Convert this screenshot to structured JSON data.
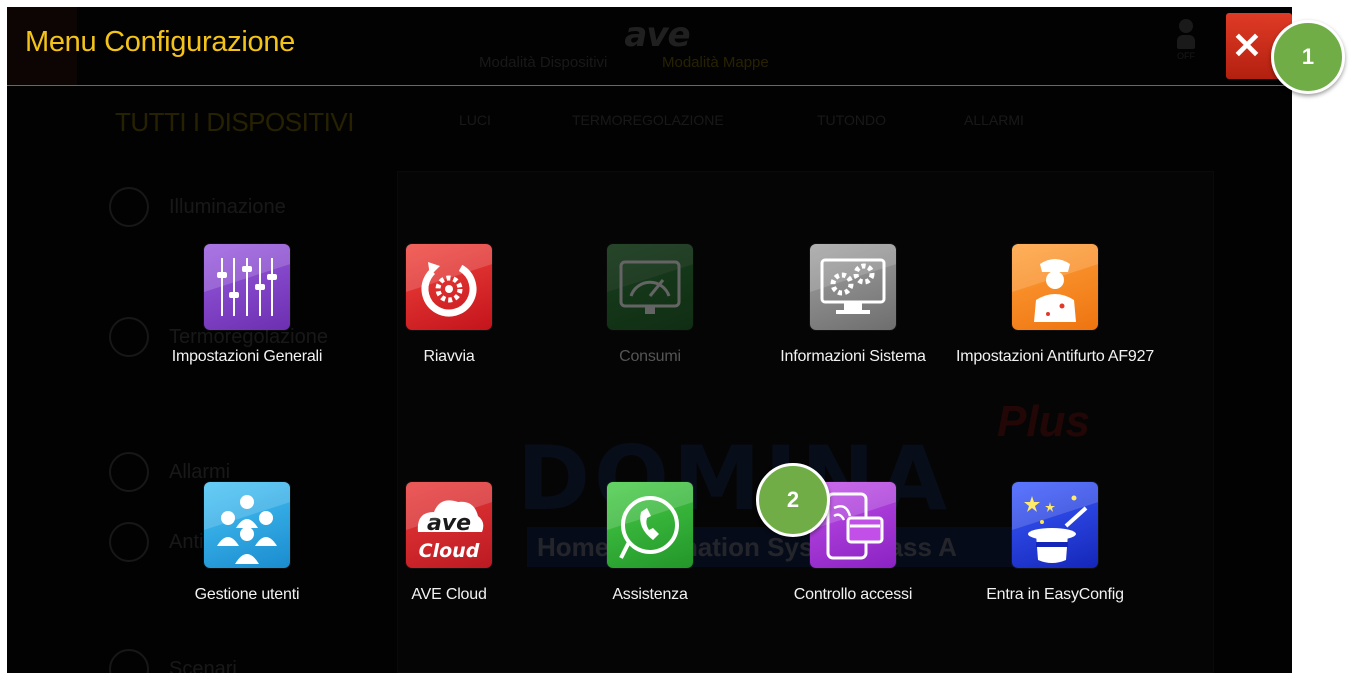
{
  "menu": {
    "title": "Menu Configurazione",
    "close_symbol": "✕"
  },
  "background": {
    "brand": "ave",
    "modes": [
      "Modalità Dispositivi",
      "Modalità Mappe"
    ],
    "user_status": "OFF",
    "all_devices": "TUTTI I DISPOSITIVI",
    "tabs": [
      "LUCI",
      "TERMOREGOLAZIONE",
      "TUTONDO",
      "ALLARMI"
    ],
    "sidebar": [
      "Illuminazione",
      "Termoregolazione",
      "Allarmi",
      "Antifurto",
      "Scenari"
    ],
    "product": "DOMINA",
    "product_suffix": "Plus",
    "tagline": "Home Automation System class A"
  },
  "tiles": [
    {
      "label": "Impostazioni Generali",
      "icon": "sliders-icon",
      "color": "#7b3fbf",
      "enabled": true
    },
    {
      "label": "Riavvia",
      "icon": "restart-gear-icon",
      "color": "#e3262b",
      "enabled": true
    },
    {
      "label": "Consumi",
      "icon": "gauge-meter-icon",
      "color": "#2e8b3a",
      "enabled": false
    },
    {
      "label": "Informazioni Sistema",
      "icon": "computer-gears-icon",
      "color": "#8c8c8c",
      "enabled": true
    },
    {
      "label": "Impostazioni Antifurto AF927",
      "icon": "guard-icon",
      "color": "#f5891e",
      "enabled": true
    },
    {
      "label": "Gestione utenti",
      "icon": "users-group-icon",
      "color": "#2aa9e6",
      "enabled": true
    },
    {
      "label": "AVE Cloud",
      "icon": "ave-cloud-icon",
      "color": "#d8232a",
      "enabled": true,
      "icon_text": [
        "ave",
        "Cloud"
      ]
    },
    {
      "label": "Assistenza",
      "icon": "phone-support-icon",
      "color": "#35b635",
      "enabled": true
    },
    {
      "label": "Controllo accessi",
      "icon": "access-card-icon",
      "color": "#a43bd6",
      "enabled": true
    },
    {
      "label": "Entra in EasyConfig",
      "icon": "magic-hat-icon",
      "color": "#1f3fd8",
      "enabled": true
    }
  ],
  "callouts": [
    "1",
    "2"
  ],
  "colors": {
    "title": "#f3c31a",
    "close": "#c9301c",
    "callout": "#70ad47",
    "rule": "#5d61a7"
  }
}
